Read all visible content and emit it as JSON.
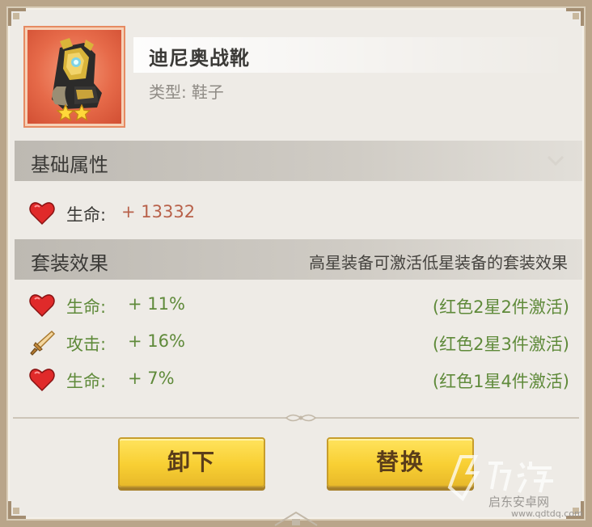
{
  "item": {
    "name": "迪尼奥战靴",
    "type_label": "类型:",
    "type_value": "鞋子",
    "stars": 2,
    "quality_color": "#e76a4b"
  },
  "base_section": {
    "title": "基础属性",
    "stats": [
      {
        "icon": "heart-icon",
        "name": "生命:",
        "value": "+ 13332"
      }
    ]
  },
  "set_section": {
    "title": "套装效果",
    "hint": "高星装备可激活低星装备的套装效果",
    "effects": [
      {
        "icon": "heart-icon",
        "name": "生命:",
        "value": "+ 11%",
        "condition": "(红色2星2件激活)"
      },
      {
        "icon": "sword-icon",
        "name": "攻击:",
        "value": "+ 16%",
        "condition": "(红色2星3件激活)"
      },
      {
        "icon": "heart-icon",
        "name": "生命:",
        "value": "+ 7%",
        "condition": "(红色1星4件激活)"
      }
    ]
  },
  "buttons": {
    "unequip": "卸下",
    "replace": "替换"
  },
  "watermark": {
    "text": "启东安卓网",
    "url": "www.qdtdq.com"
  }
}
